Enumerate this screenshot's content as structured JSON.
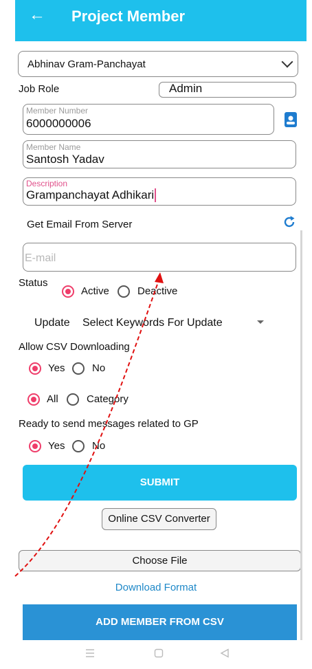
{
  "header": {
    "title": "Project Member",
    "back_icon": "arrow-left-icon"
  },
  "form": {
    "gram_select": "Abhinav Gram-Panchayat",
    "job_role_label": "Job Role",
    "job_role_value": "Admin",
    "member_number": {
      "label": "Member Number",
      "value": "6000000006"
    },
    "member_name": {
      "label": "Member Name",
      "value": "Santosh Yadav"
    },
    "description": {
      "label": "Description",
      "value": "Grampanchayat Adhikari"
    },
    "email_server_label": "Get Email From Server",
    "email_placeholder": "E-mail",
    "status": {
      "label": "Status",
      "active": "Active",
      "deactive": "Deactive"
    },
    "update": {
      "label": "Update",
      "value": "Select Keywords For Update"
    },
    "csv": {
      "label": "Allow CSV Downloading",
      "yes": "Yes",
      "no": "No"
    },
    "scope": {
      "all": "All",
      "category": "Category"
    },
    "gp_messages": {
      "label": "Ready to send messages related to GP",
      "yes": "Yes",
      "no": "No"
    }
  },
  "buttons": {
    "submit": "SUBMIT",
    "online_csv": "Online CSV Converter",
    "choose_file": "Choose File",
    "download_format": "Download Format",
    "add_member_csv": "ADD MEMBER FROM CSV"
  },
  "colors": {
    "accent": "#1ec0ec",
    "radio": "#ef3d6a",
    "button_dark": "#2a92d5",
    "link": "#1e88c8"
  }
}
